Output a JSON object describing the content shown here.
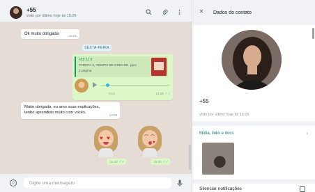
{
  "chat": {
    "contact_name": "+55",
    "contact_status": "visto por último hoje às 15:26",
    "messages": {
      "thanks": {
        "text": "Ok muito obrigada",
        "time": "15:01"
      },
      "day_divider": "SEXTA-FEIRA",
      "document": {
        "sender": "+55 11 9",
        "file_name": "TAREFA 6, TEMPO DE CRECHE .pptx",
        "pages": "1 página",
        "time": "13:58"
      },
      "voice": {
        "duration": "0:13",
        "time": "13:58"
      },
      "reply": {
        "line1": "Muito obrigada,  eu amo suas explicações,",
        "line2": "tenho aprendido muito com vocês.",
        "time": "14:09"
      },
      "sticker1_time": "15:20",
      "sticker2_time": "15:20"
    },
    "composer_placeholder": "Digite uma mensagem"
  },
  "contact_panel": {
    "title": "Dados do contato",
    "name": "+55",
    "status": "visto por último hoje às 15:26",
    "media_label": "Mídia, links e docs",
    "mute_label": "Silenciar notificações"
  },
  "icons": {
    "search": "search-icon",
    "attach": "paperclip-icon",
    "menu": "menu-icon",
    "close": "close-icon",
    "emoji": "emoji-icon",
    "mic": "mic-icon",
    "play": "play-icon",
    "chevron": "chevron-right-icon",
    "ticks": "double-check-icon"
  },
  "colors": {
    "outgoing_bubble": "#dcf8c6",
    "incoming_bubble": "#ffffff",
    "chat_background": "#e5ddd5",
    "accent": "#008069",
    "read_ticks": "#53bdeb"
  }
}
